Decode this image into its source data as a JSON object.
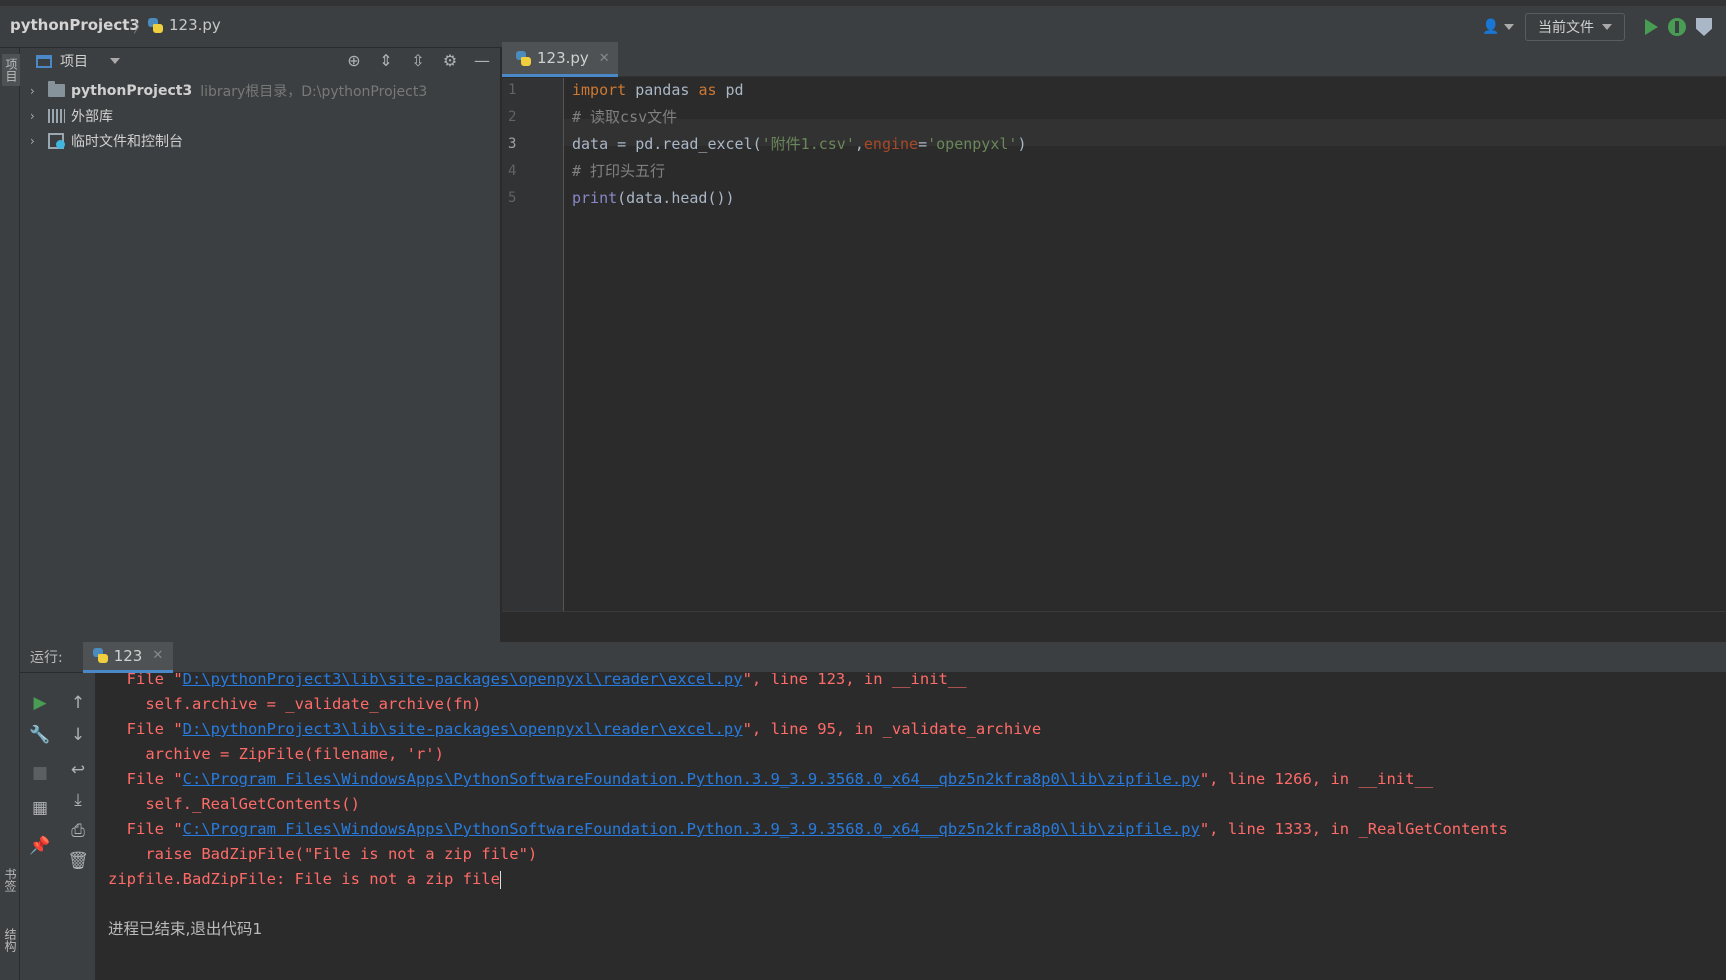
{
  "navbar": {
    "project": "pythonProject3",
    "file": "123.py",
    "config": "当前文件"
  },
  "stripe": {
    "project": "项目",
    "bookmarks": "书签",
    "structure": "结构"
  },
  "project_panel": {
    "title": "项目",
    "tree": [
      {
        "label": "pythonProject3",
        "path": "library根目录，D:\\pythonProject3"
      },
      {
        "label": "外部库"
      },
      {
        "label": "临时文件和控制台"
      }
    ]
  },
  "editor": {
    "tab": "123.py",
    "line_numbers": [
      "1",
      "2",
      "3",
      "4",
      "5"
    ],
    "lines": {
      "l1": {
        "kw1": "import",
        "mid": " pandas ",
        "kw2": "as",
        "end": " pd"
      },
      "l2": {
        "comment": "# 读取csv文件"
      },
      "l3": {
        "a": "data = pd.read_excel(",
        "s1": "'附件1.csv'",
        "b": ",",
        "p": "engine",
        "c": "=",
        "s2": "'openpyxl'",
        "d": ")"
      },
      "l4": {
        "comment": "# 打印头五行"
      },
      "l5": {
        "fn": "print",
        "rest": "(data.head())"
      }
    }
  },
  "run": {
    "label": "运行:",
    "tab": "123",
    "console": [
      {
        "pre": "  File \"",
        "link": "D:\\pythonProject3\\lib\\site-packages\\openpyxl\\reader\\excel.py",
        "post": "\", line 123, in __init__"
      },
      {
        "text": "    self.archive = _validate_archive(fn)"
      },
      {
        "pre": "  File \"",
        "link": "D:\\pythonProject3\\lib\\site-packages\\openpyxl\\reader\\excel.py",
        "post": "\", line 95, in _validate_archive"
      },
      {
        "text": "    archive = ZipFile(filename, 'r')"
      },
      {
        "pre": "  File \"",
        "link": "C:\\Program Files\\WindowsApps\\PythonSoftwareFoundation.Python.3.9_3.9.3568.0_x64__qbz5n2kfra8p0\\lib\\zipfile.py",
        "post": "\", line 1266, in __init__"
      },
      {
        "text": "    self._RealGetContents()"
      },
      {
        "pre": "  File \"",
        "link": "C:\\Program Files\\WindowsApps\\PythonSoftwareFoundation.Python.3.9_3.9.3568.0_x64__qbz5n2kfra8p0\\lib\\zipfile.py",
        "post": "\", line 1333, in _RealGetContents"
      },
      {
        "text": "    raise BadZipFile(\"File is not a zip file\")"
      },
      {
        "text": "zipfile.BadZipFile: File is not a zip file"
      }
    ],
    "exit_message": "进程已结束,退出代码1"
  }
}
